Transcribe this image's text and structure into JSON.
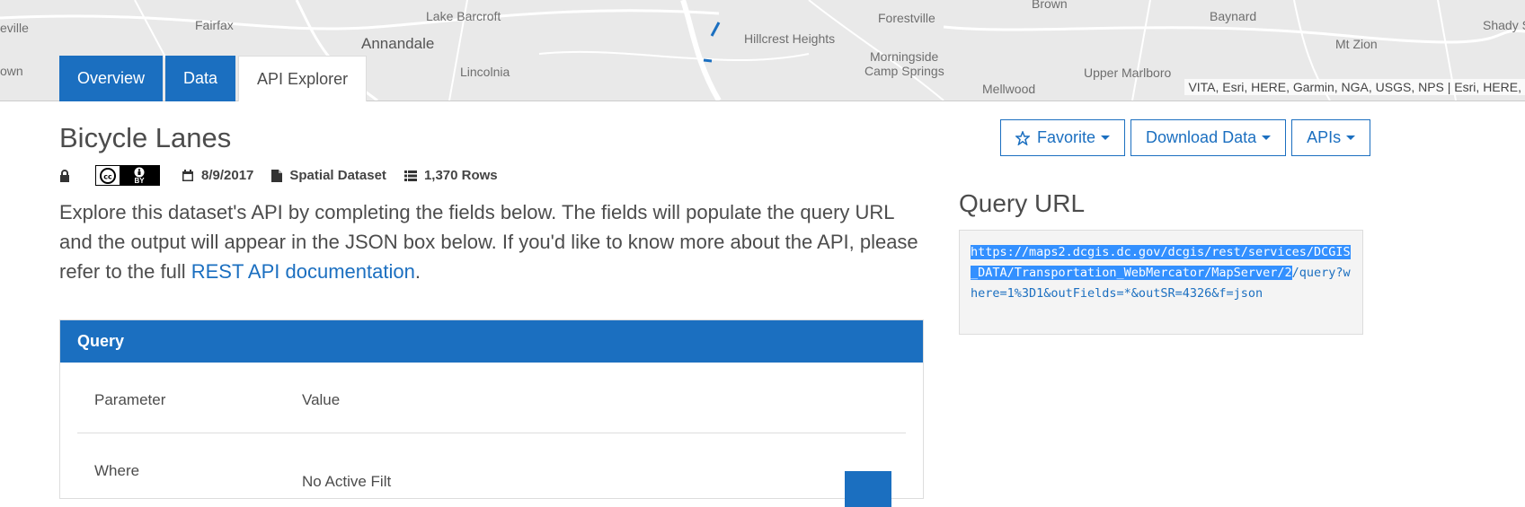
{
  "map": {
    "places": [
      {
        "name": "eville",
        "big": false
      },
      {
        "name": "Fairfax",
        "big": false
      },
      {
        "name": "Lake Barcroft",
        "big": false
      },
      {
        "name": "Annandale",
        "big": true
      },
      {
        "name": "Lincolnia",
        "big": false
      },
      {
        "name": "Hillcrest Heights",
        "big": false
      },
      {
        "name": "Forestville",
        "big": false
      },
      {
        "name": "Morningside",
        "big": false
      },
      {
        "name": "Camp Springs",
        "big": false
      },
      {
        "name": "Brown",
        "big": false
      },
      {
        "name": "Baynard",
        "big": false
      },
      {
        "name": "Mt Zion",
        "big": false
      },
      {
        "name": "Upper Marlboro",
        "big": false
      },
      {
        "name": "Mellwood",
        "big": false
      },
      {
        "name": "Shady S",
        "big": false
      },
      {
        "name": "own",
        "big": false
      }
    ],
    "attribution": "VITA, Esri, HERE, Garmin, NGA, USGS, NPS | Esri, HERE,"
  },
  "tabs": [
    {
      "label": "Overview"
    },
    {
      "label": "Data"
    },
    {
      "label": "API Explorer"
    }
  ],
  "dataset": {
    "title": "Bicycle Lanes",
    "date": "8/9/2017",
    "type": "Spatial Dataset",
    "rows": "1,370 Rows",
    "license_badge": "BY"
  },
  "description": {
    "text_before": "Explore this dataset's API by completing the fields below. The fields will populate the query URL and the output will appear in the JSON box below. If you'd like to know more about the API, please refer to the full ",
    "link_text": "REST API documentation",
    "text_after": "."
  },
  "actions": {
    "favorite": "Favorite",
    "download": "Download Data",
    "apis": "APIs"
  },
  "query_url": {
    "title": "Query URL",
    "selected_part": "https://maps2.dcgis.dc.gov/dcgis/rest/services/DCGIS_DATA/Transportation_WebMercator/MapServer/2",
    "rest_part": "/query?where=1%3D1&outFields=*&outSR=4326&f=json"
  },
  "query_panel": {
    "title": "Query",
    "col_parameter": "Parameter",
    "col_value": "Value",
    "where_label": "Where",
    "where_value": "No Active Filt"
  },
  "colors": {
    "accent": "#1b6fc0",
    "selection": "#3390ff"
  }
}
